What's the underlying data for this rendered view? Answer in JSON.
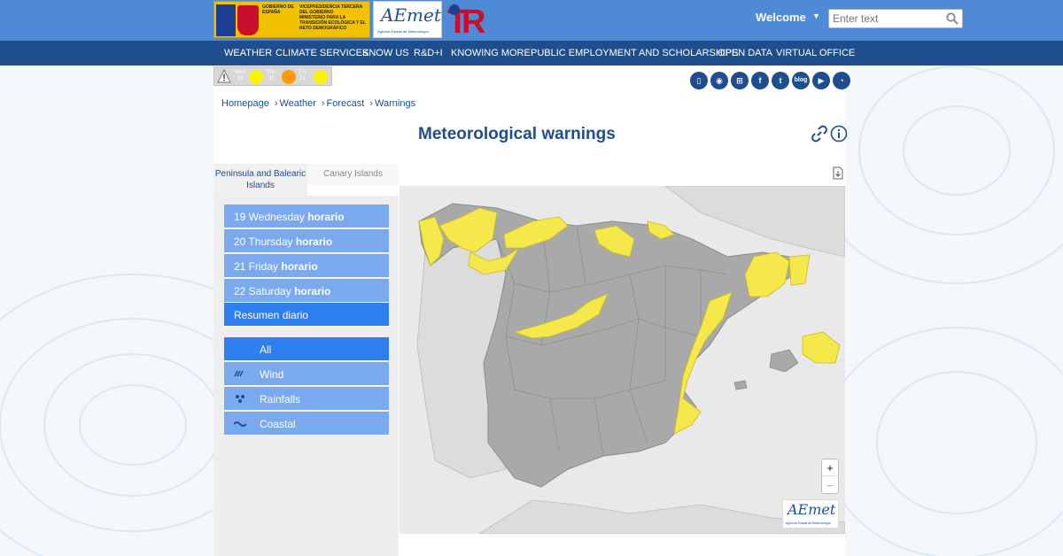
{
  "header": {
    "gov_text_1": "VICEPRESIDENCIA TERCERA DEL GOBIERNO",
    "gov_text_2": "MINISTERIO PARA LA TRANSICIÓN ECOLÓGICA Y EL RETO DEMOGRÁFICO",
    "gov_text_0": "GOBIERNO DE ESPAÑA",
    "aemet_logo": "AEmet",
    "aemet_sub": "Agencia Estatal de Meteorología",
    "welcome": "Welcome",
    "search_placeholder": "Enter text"
  },
  "nav": {
    "items": [
      "WEATHER",
      "CLIMATE SERVICES",
      "KNOW US",
      "R&D+I",
      "KNOWING MORE",
      "PUBLIC EMPLOYMENT AND SCHOLARSHIPS",
      "OPEN DATA",
      "VIRTUAL OFFICE"
    ]
  },
  "mini_forecast": {
    "days": [
      {
        "name": "Wed",
        "num": "19",
        "color": "#fff200"
      },
      {
        "name": "Thu",
        "num": "20",
        "color": "#ff9a00"
      },
      {
        "name": "Fri",
        "num": "21",
        "color": "#fff200"
      }
    ]
  },
  "social": {
    "blog_label": "blog"
  },
  "breadcrumb": {
    "items": [
      "Homepage",
      "Weather",
      "Forecast",
      "Warnings"
    ]
  },
  "page": {
    "title": "Meteorological warnings"
  },
  "tabs": {
    "active": "Peninsula and Balearic Islands",
    "inactive": "Canary Islands"
  },
  "days": [
    {
      "label": "19 Wednesday",
      "suffix": "horario"
    },
    {
      "label": "20 Thursday",
      "suffix": "horario"
    },
    {
      "label": "21 Friday",
      "suffix": "horario"
    },
    {
      "label": "22 Saturday",
      "suffix": "horario"
    }
  ],
  "summary": {
    "label": "Resumen diario"
  },
  "filters": {
    "all": "All",
    "wind": "Wind",
    "rainfalls": "Rainfalls",
    "coastal": "Coastal"
  },
  "map": {
    "zoom_in": "+",
    "zoom_out": "−",
    "logo": "AEmet",
    "logo_sub": "Agencia Estatal de Meteorología",
    "warning_color": "#f5e84a",
    "land_color": "#a9a9a9",
    "sea_color": "#e9e9e9"
  }
}
